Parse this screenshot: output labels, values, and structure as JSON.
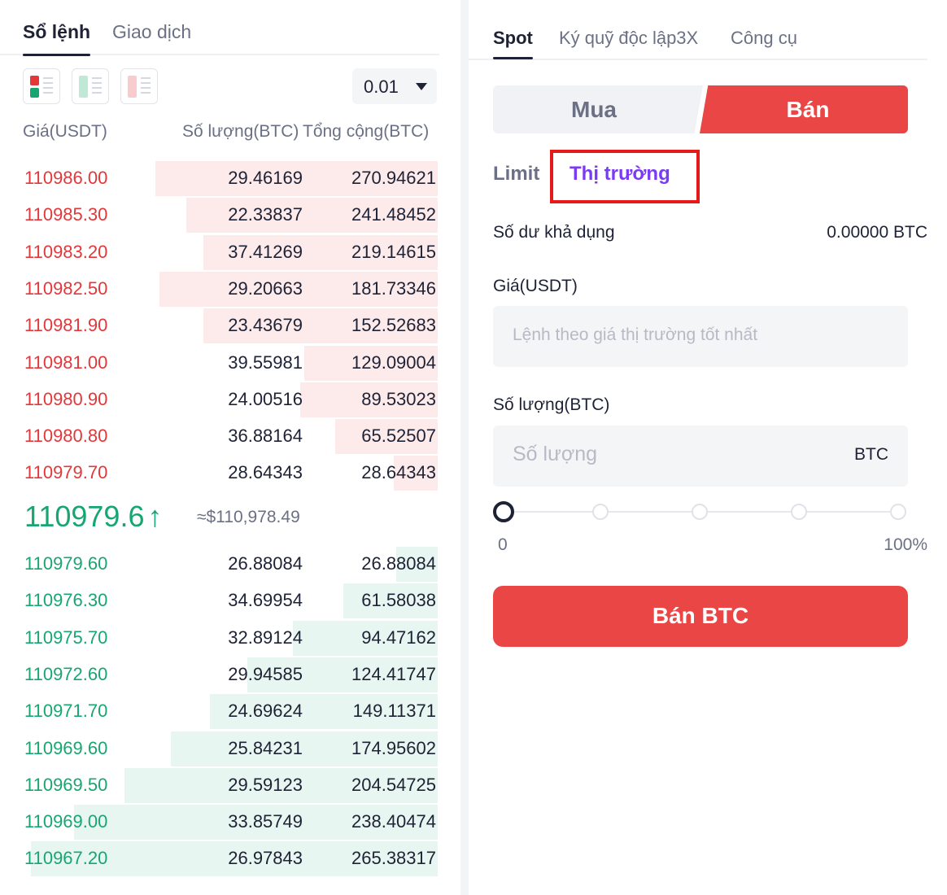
{
  "orderbook": {
    "tabs": [
      {
        "label": "Sổ lệnh"
      },
      {
        "label": "Giao dịch"
      }
    ],
    "views": [
      {
        "icon": "orderbook-both-icon"
      },
      {
        "icon": "orderbook-bids-icon"
      },
      {
        "icon": "orderbook-asks-icon"
      }
    ],
    "tick_size": "0.01",
    "headers": {
      "price": "Giá(USDT)",
      "qty": "Số lượng(BTC)",
      "total": "Tổng cộng(BTC)"
    },
    "asks": [
      {
        "price": "110986.00",
        "qty": "29.46169",
        "total": "270.94621",
        "depth": 0.645
      },
      {
        "price": "110985.30",
        "qty": "22.33837",
        "total": "241.48452",
        "depth": 0.575
      },
      {
        "price": "110983.20",
        "qty": "37.41269",
        "total": "219.14615",
        "depth": 0.535
      },
      {
        "price": "110982.50",
        "qty": "29.20663",
        "total": "181.73346",
        "depth": 0.635
      },
      {
        "price": "110981.90",
        "qty": "23.43679",
        "total": "152.52683",
        "depth": 0.535
      },
      {
        "price": "110981.00",
        "qty": "39.55981",
        "total": "129.09004",
        "depth": 0.305
      },
      {
        "price": "110980.90",
        "qty": "24.00516",
        "total": "89.53023",
        "depth": 0.315
      },
      {
        "price": "110980.80",
        "qty": "36.88164",
        "total": "65.52507",
        "depth": 0.235
      },
      {
        "price": "110979.70",
        "qty": "28.64343",
        "total": "28.64343",
        "depth": 0.1
      }
    ],
    "last_price": "110979.6",
    "last_arrow": "↑",
    "last_usd": "≈$110,978.49",
    "bids": [
      {
        "price": "110979.60",
        "qty": "26.88084",
        "total": "26.88084",
        "depth": 0.095
      },
      {
        "price": "110976.30",
        "qty": "34.69954",
        "total": "61.58038",
        "depth": 0.215
      },
      {
        "price": "110975.70",
        "qty": "32.89124",
        "total": "94.47162",
        "depth": 0.33
      },
      {
        "price": "110972.60",
        "qty": "29.94585",
        "total": "124.41747",
        "depth": 0.435
      },
      {
        "price": "110971.70",
        "qty": "24.69624",
        "total": "149.11371",
        "depth": 0.52
      },
      {
        "price": "110969.60",
        "qty": "25.84231",
        "total": "174.95602",
        "depth": 0.61
      },
      {
        "price": "110969.50",
        "qty": "29.59123",
        "total": "204.54725",
        "depth": 0.715
      },
      {
        "price": "110969.00",
        "qty": "33.85749",
        "total": "238.40474",
        "depth": 0.83
      },
      {
        "price": "110967.20",
        "qty": "26.97843",
        "total": "265.38317",
        "depth": 0.93
      }
    ]
  },
  "trade": {
    "tabs": [
      {
        "label": "Spot"
      },
      {
        "label": "Ký quỹ độc lập3X"
      },
      {
        "label": "Công cụ"
      }
    ],
    "side": {
      "buy": "Mua",
      "sell": "Bán"
    },
    "order_types": {
      "limit": "Limit",
      "market": "Thị trường"
    },
    "balance_label": "Số dư khả dụng",
    "balance_value": "0.00000 BTC",
    "price_label": "Giá(USDT)",
    "price_placeholder": "Lệnh theo giá thị trường tốt nhất",
    "qty_label": "Số lượng(BTC)",
    "qty_placeholder": "Số lượng",
    "qty_unit": "BTC",
    "slider_min": "0",
    "slider_max": "100%",
    "slider_value": 0,
    "submit_label": "Bán BTC"
  },
  "colors": {
    "ask": "#e4373a",
    "bid": "#17a672",
    "sell_accent": "#ea4646",
    "market_accent": "#7a3bf5",
    "highlight": "#e61919"
  }
}
